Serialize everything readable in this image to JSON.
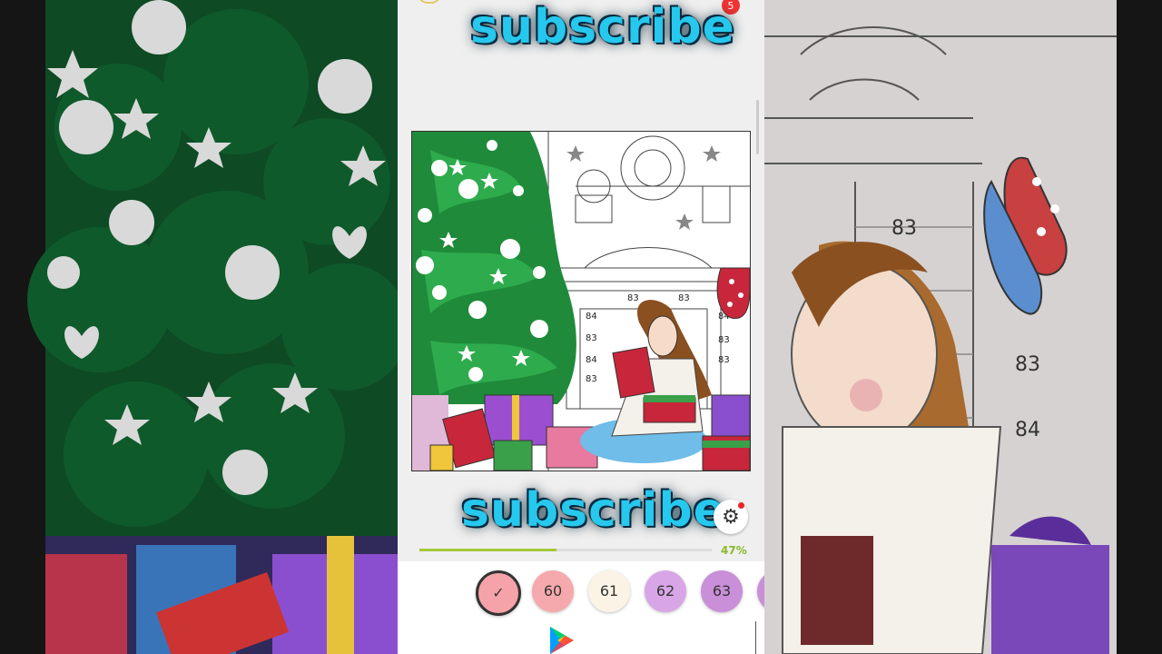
{
  "overlay": {
    "subscribe_top": "subscribe",
    "subscribe_bottom": "subscribe"
  },
  "notification_count": "5",
  "canvas": {
    "numbers": [
      "83",
      "83",
      "84",
      "83",
      "84",
      "83",
      "83",
      "83",
      "84"
    ]
  },
  "background_right": {
    "numbers": [
      "83",
      "83",
      "84"
    ]
  },
  "progress": {
    "label": "47%",
    "fraction": 0.47
  },
  "palette": {
    "swatches": [
      {
        "label": "✓",
        "color": "#f5a3a8",
        "selected": true
      },
      {
        "label": "60",
        "color": "#f6a9ad",
        "selected": false
      },
      {
        "label": "61",
        "color": "#fbf4e6",
        "selected": false
      },
      {
        "label": "62",
        "color": "#d8a6e6",
        "selected": false
      },
      {
        "label": "63",
        "color": "#c98fd8",
        "selected": false
      },
      {
        "label": "",
        "color": "#c98fd8",
        "selected": false
      }
    ]
  },
  "colors": {
    "accent": "#26c8ee",
    "progress": "#a4c83a",
    "badge": "#e33333"
  },
  "icons": {
    "settings": "gear-icon",
    "store": "play-store-icon"
  }
}
